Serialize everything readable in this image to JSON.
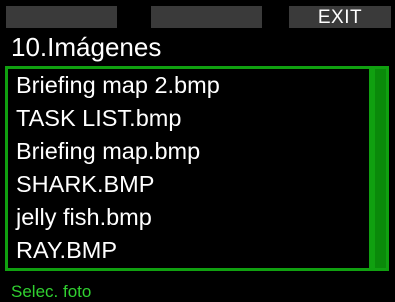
{
  "softkeys": {
    "left_label": "",
    "middle_label": "",
    "right_label": "EXIT"
  },
  "title": "10.Imágenes",
  "files": [
    "Briefing map 2.bmp",
    "TASK LIST.bmp",
    "Briefing map.bmp",
    "SHARK.BMP",
    "jelly fish.bmp",
    "RAY.BMP"
  ],
  "scroll_fraction": 1.0,
  "hint": "Selec. foto",
  "colors": {
    "accent_green": "#10a010",
    "hint_green": "#30d030",
    "softkey_bg": "#3a3a3a"
  }
}
